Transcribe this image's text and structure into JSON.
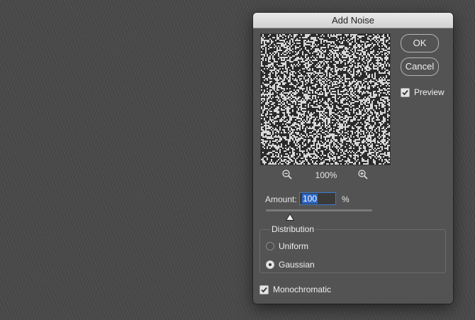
{
  "dialog": {
    "title": "Add Noise",
    "ok_label": "OK",
    "cancel_label": "Cancel",
    "preview_label": "Preview",
    "preview_checked": true,
    "zoom_level": "100%",
    "zoom_out_icon": "zoom-out-icon",
    "zoom_in_icon": "zoom-in-icon",
    "amount_label": "Amount:",
    "amount_value": "100",
    "amount_unit": "%",
    "distribution_label": "Distribution",
    "distribution_options": [
      {
        "label": "Uniform",
        "selected": false
      },
      {
        "label": "Gaussian",
        "selected": true
      }
    ],
    "monochromatic_label": "Monochromatic",
    "monochromatic_checked": true
  },
  "colors": {
    "dialog_bg": "#535353",
    "accent": "#2e66c4",
    "canvas_bg": "#4a4a4a"
  }
}
